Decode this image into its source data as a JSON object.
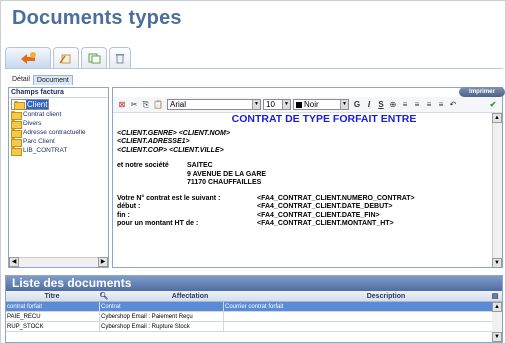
{
  "page": {
    "title": "Documents types"
  },
  "tabs": [
    {
      "label": "Détail"
    },
    {
      "label": "Document"
    }
  ],
  "left_panel": {
    "header": "Champs factura",
    "items": [
      {
        "label": "Client",
        "selected": true
      },
      {
        "label": "Contrat client"
      },
      {
        "label": "Divers"
      },
      {
        "label": "Adresse contractuelle"
      },
      {
        "label": "Parc Client"
      },
      {
        "label": "LIB_CONTRAT"
      }
    ]
  },
  "editor": {
    "print_label": "Imprimer",
    "font": "Arial",
    "size": "10",
    "color": "Noir",
    "format": [
      "G",
      "I",
      "S",
      "⊕"
    ],
    "title": "CONTRAT DE TYPE FORFAIT ENTRE",
    "client_lines": [
      "<CLIENT.GENRE> <CLIENT.NOM>",
      "<CLIENT.ADRESSE1>",
      "<CLIENT.COP> <CLIENT.VILLE>"
    ],
    "company_label": "et notre société",
    "company_lines": [
      "SAITEC",
      "9 AVENUE DE LA GARE",
      "71170 CHAUFFAILLES"
    ],
    "contract_rows": [
      {
        "k": "Votre N° contrat est le suivant :",
        "v": "<FA4_CONTRAT_CLIENT.NUMERO_CONTRAT>"
      },
      {
        "k": "début :",
        "v": "<FA4_CONTRAT_CLIENT.DATE_DEBUT>"
      },
      {
        "k": "fin :",
        "v": "<FA4_CONTRAT_CLIENT.DATE_FIN>"
      },
      {
        "k": "pour un montant HT de :",
        "v": "<FA4_CONTRAT_CLIENT.MONTANT_HT>"
      }
    ]
  },
  "documents": {
    "title": "Liste des documents",
    "columns": [
      "Titre",
      "Affectation",
      "Description"
    ],
    "rows": [
      {
        "titre": "contrat forfait",
        "affectation": "Contrat",
        "description": "Courrier contrat forfait",
        "selected": true
      },
      {
        "titre": "PAIE_RECU",
        "affectation": "Cybershop Email : Paiement Reçu",
        "description": ""
      },
      {
        "titre": "RUP_STOCK",
        "affectation": "Cybershop Email : Rupture Stock",
        "description": ""
      }
    ]
  }
}
